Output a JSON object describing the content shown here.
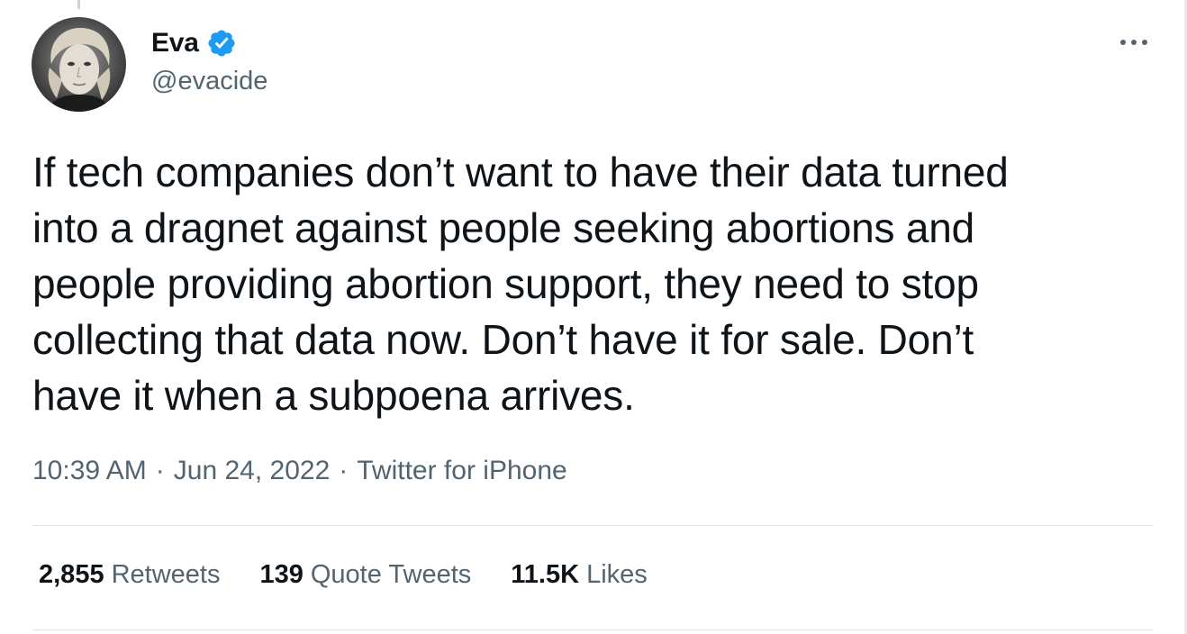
{
  "tweet": {
    "author": {
      "display_name": "Eva",
      "handle": "@evacide",
      "verified": true,
      "verified_color": "#1d9bf0"
    },
    "text": "If tech companies don’t want to have their data turned\ninto a dragnet against people seeking abortions and\npeople providing abortion support, they need to stop\ncollecting that data now. Don’t have it for sale. Don’t\nhave it when a subpoena arrives.",
    "time": "10:39 AM",
    "date": "Jun 24, 2022",
    "source": "Twitter for iPhone",
    "separator": "·",
    "stats": {
      "retweets_count": "2,855",
      "retweets_label": "Retweets",
      "quote_tweets_count": "139",
      "quote_tweets_label": "Quote Tweets",
      "likes_count": "11.5K",
      "likes_label": "Likes"
    }
  },
  "icons": {
    "more": "more-options-icon",
    "verified": "verified-badge-icon"
  },
  "colors": {
    "text_primary": "#0f1419",
    "text_secondary": "#536471",
    "divider": "#e1e4e6"
  }
}
